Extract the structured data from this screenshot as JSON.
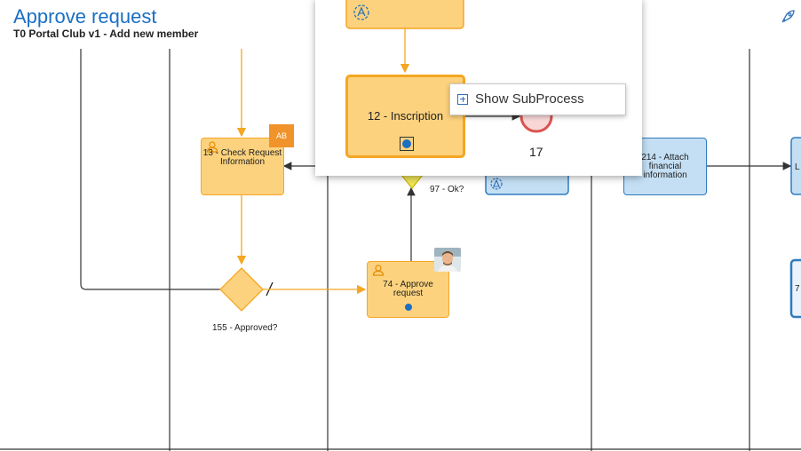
{
  "header": {
    "title": "Approve request",
    "subtitle": "T0 Portal Club v1 - Add new member"
  },
  "tasks": {
    "check_request": "13 - Check Request Information",
    "approve_request": "74 - Approve request",
    "inscription": "12 - Inscription",
    "attach_financial": "214 - Attach financial information",
    "partial_right_task": "L",
    "partial_right_task2": "7"
  },
  "gateways": {
    "approved": "155 - Approved?",
    "ok": "97 - Ok?"
  },
  "events": {
    "end_17": "17"
  },
  "badges": {
    "assignee_initials": "AB"
  },
  "context_menu": {
    "show_subprocess": "Show SubProcess"
  },
  "icons": {
    "top_right": "rocket-icon"
  },
  "colors": {
    "title_blue": "#1a6fc4",
    "task_orange_fill": "#fcd27e",
    "task_orange_stroke": "#f5a623",
    "task_blue_fill": "#c4dff4",
    "task_blue_stroke": "#2f7bbd",
    "end_event_red": "#d9534f"
  }
}
